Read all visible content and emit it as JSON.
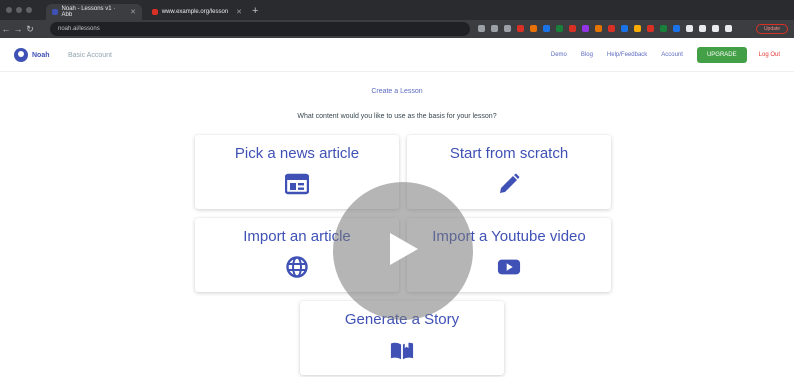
{
  "browser": {
    "tabs": [
      {
        "title": "Noah - Lessons v1 · Abb"
      },
      {
        "title": "www.example.org/lesson"
      }
    ],
    "url": "noah.ai/lessons",
    "update_label": "Update"
  },
  "header": {
    "logo_text": "Noah",
    "account_type": "Basic Account",
    "nav": [
      "Demo",
      "Blog",
      "Help/Feedback",
      "Account"
    ],
    "upgrade_label": "UPGRADE",
    "logout_label": "Log Out"
  },
  "main": {
    "title": "Create a Lesson",
    "question": "What content would you like to use as the basis for your lesson?",
    "options": [
      {
        "label": "Pick a news article",
        "icon": "newspaper-icon"
      },
      {
        "label": "Start from scratch",
        "icon": "pencil-icon"
      },
      {
        "label": "Import an article",
        "icon": "globe-icon"
      },
      {
        "label": "Import a Youtube video",
        "icon": "youtube-icon"
      },
      {
        "label": "Generate a Story",
        "icon": "book-icon"
      }
    ]
  },
  "video": {
    "overlay_icon": "play-icon"
  },
  "colors": {
    "accent": "#3f51b5",
    "upgrade": "#43a047",
    "logout": "#e53935",
    "chrome_dark": "#202124"
  }
}
